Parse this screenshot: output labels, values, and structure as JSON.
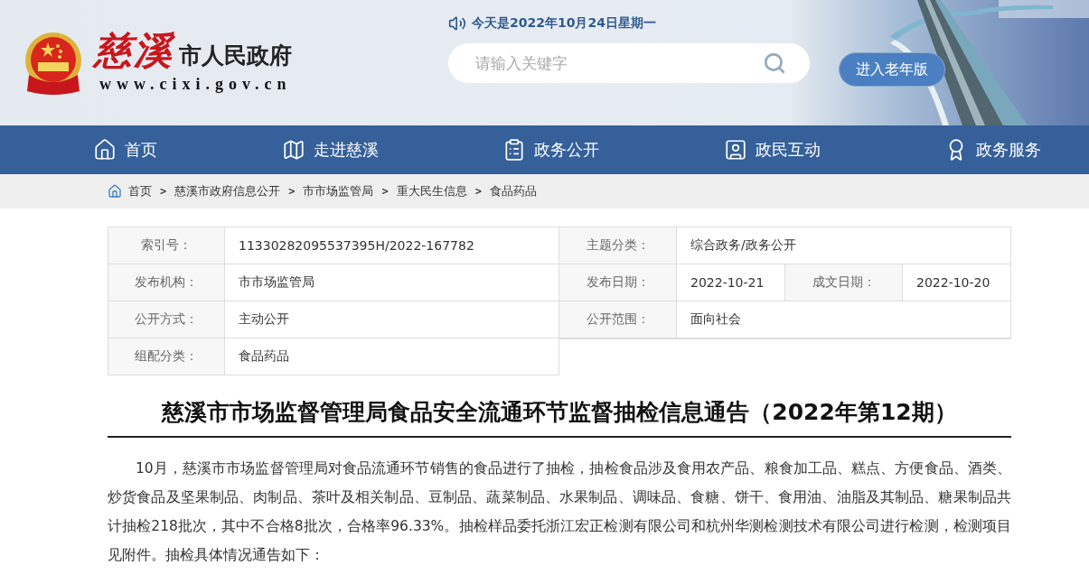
{
  "header": {
    "logo_calligraphy": "慈溪",
    "logo_title": "市人民政府",
    "logo_url": "www.cixi.gov.cn",
    "date": "今天是2022年10月24日星期一",
    "search": {
      "placeholder": "请输入关键字"
    },
    "elder_button": "进入老年版"
  },
  "nav": [
    {
      "label": "首页"
    },
    {
      "label": "走进慈溪"
    },
    {
      "label": "政务公开"
    },
    {
      "label": "政民互动"
    },
    {
      "label": "政务服务"
    }
  ],
  "breadcrumb": [
    {
      "kind": "link",
      "text": "首页"
    },
    {
      "kind": "separator",
      "text": ">"
    },
    {
      "kind": "link",
      "text": "慈溪市政府信息公开"
    },
    {
      "kind": "separator",
      "text": ">"
    },
    {
      "kind": "link",
      "text": "市市场监管局"
    },
    {
      "kind": "separator",
      "text": ">"
    },
    {
      "kind": "link",
      "text": "重大民生信息"
    },
    {
      "kind": "separator",
      "text": ">"
    },
    {
      "kind": "link",
      "text": "食品药品"
    }
  ],
  "info_table": [
    [
      {
        "label": "索引号：",
        "value": "11330282095537395H/2022-167782"
      },
      {
        "label": "主题分类：",
        "value": "综合政务/政务公开"
      }
    ],
    [
      {
        "label": "发布机构：",
        "value": "市市场监管局"
      },
      {
        "label": "发布日期：",
        "value": "2022-10-21"
      },
      {
        "label": "成文日期：",
        "value": "2022-10-20"
      }
    ],
    [
      {
        "label": "公开方式：",
        "value": "主动公开"
      },
      {
        "label": "公开范围：",
        "value": "面向社会"
      }
    ],
    [
      {
        "label": "组配分类：",
        "value": "食品药品"
      }
    ]
  ],
  "article": {
    "title": "慈溪市市场监督管理局食品安全流通环节监督抽检信息通告（2022年第12期）",
    "paragraphs": [
      "10月，慈溪市市场监督管理局对食品流通环节销售的食品进行了抽检，抽检食品涉及食用农产品、粮食加工品、糕点、方便食品、酒类、炒货食品及坚果制品、肉制品、茶叶及相关制品、豆制品、蔬菜制品、水果制品、调味品、食糖、饼干、食用油、油脂及其制品、糖果制品共计抽检218批次，其中不合格8批次，合格率96.33%。抽检样品委托浙江宏正检测有限公司和杭州华测检测技术有限公司进行检测，检测项目见附件。抽检具体情况通告如下："
    ]
  }
}
